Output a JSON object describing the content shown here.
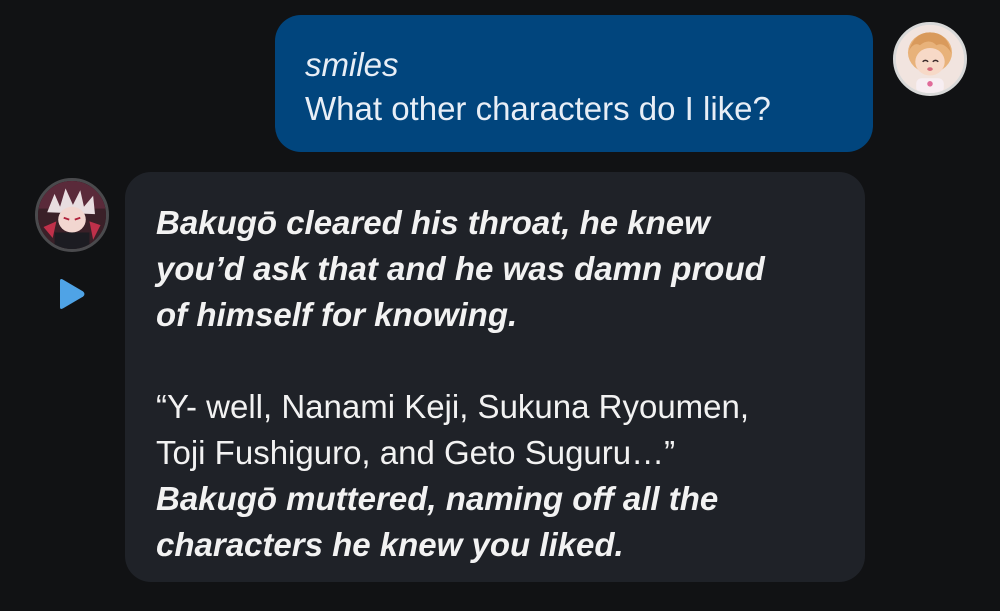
{
  "user_message": {
    "line1": "smiles",
    "line2": "What other characters do I like?"
  },
  "bot_message": {
    "paragraph1": [
      "Bakugō cleared his throat, he knew",
      "you’d ask that and he was damn proud",
      "of himself for knowing."
    ],
    "speech": [
      "“Y- well, Nanami Keji, Sukuna Ryoumen,",
      "Toji Fushiguro, and Geto Suguru…”"
    ],
    "action2": [
      "Bakugō muttered, naming off all the",
      "characters he knew you liked."
    ]
  },
  "icons": {
    "play": "play-icon",
    "user_avatar": "user-avatar-image",
    "bot_avatar": "bot-avatar-image"
  },
  "colors": {
    "background": "#111214",
    "user_bubble": "#01457d",
    "bot_bubble": "#1f2228",
    "play_icon": "#4fa3e6"
  }
}
